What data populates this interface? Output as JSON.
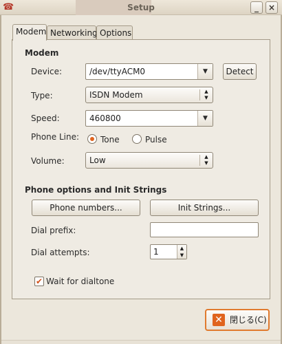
{
  "window": {
    "title": "Setup",
    "minimize_glyph": "_",
    "close_glyph": "×",
    "app_icon": "phone-icon"
  },
  "tabs": [
    {
      "label": "Modem",
      "active": true
    },
    {
      "label": "Networking",
      "active": false
    },
    {
      "label": "Options",
      "active": false
    }
  ],
  "modem_section": {
    "title": "Modem",
    "device": {
      "label": "Device:",
      "value": "/dev/ttyACM0",
      "detect_label": "Detect"
    },
    "type": {
      "label": "Type:",
      "value": "ISDN Modem"
    },
    "speed": {
      "label": "Speed:",
      "value": "460800"
    },
    "phone_line": {
      "label": "Phone Line:",
      "options": [
        {
          "label": "Tone",
          "checked": true
        },
        {
          "label": "Pulse",
          "checked": false
        }
      ]
    },
    "volume": {
      "label": "Volume:",
      "value": "Low"
    }
  },
  "init_section": {
    "title": "Phone options and Init Strings",
    "phone_numbers_label": "Phone numbers...",
    "init_strings_label": "Init Strings...",
    "dial_prefix": {
      "label": "Dial prefix:",
      "value": ""
    },
    "dial_attempts": {
      "label": "Dial attempts:",
      "value": "1"
    },
    "wait_dialtone": {
      "label": "Wait for dialtone",
      "checked": true
    }
  },
  "footer": {
    "close_label": "閉じる(C)"
  },
  "colors": {
    "accent": "#e0641e",
    "window_bg": "#ece7dc"
  }
}
